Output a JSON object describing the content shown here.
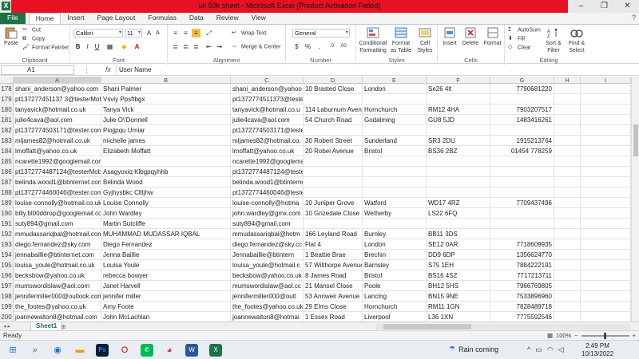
{
  "window": {
    "title": "uk 50k sheet - Microsoft Excel (Product Activation Failed)",
    "controls": [
      "?",
      "–",
      "❐",
      "✕"
    ]
  },
  "ribbon_tabs": [
    "File",
    "Home",
    "Insert",
    "Page Layout",
    "Formulas",
    "Data",
    "Review",
    "View"
  ],
  "ribbon": {
    "clipboard": {
      "paste": "Paste",
      "cut": "Cut",
      "copy": "Copy",
      "format_painter": "Format Painter",
      "label": "Clipboard"
    },
    "font": {
      "name": "Calibri",
      "size": "11",
      "label": "Font"
    },
    "alignment": {
      "wrap_text": "Wrap Text",
      "merge_center": "Merge & Center",
      "label": "Alignment"
    },
    "number": {
      "format": "General",
      "label": "Number"
    },
    "styles": {
      "conditional": "Conditional Formatting",
      "format_table": "Format as Table",
      "cell_styles": "Cell Styles",
      "label": "Styles"
    },
    "cells": {
      "insert": "Insert",
      "delete": "Delete",
      "format": "Format",
      "label": "Cells"
    },
    "editing": {
      "autosum": "AutoSum",
      "fill": "Fill",
      "clear": "Clear",
      "sort_filter": "Sort & Filter",
      "find_select": "Find & Select",
      "label": "Editing"
    }
  },
  "formula_bar": {
    "name_box": "A1",
    "fx": "fx",
    "content": "User Name"
  },
  "columns": [
    "A",
    "B",
    "C",
    "D",
    "E",
    "F",
    "G",
    "H",
    "I"
  ],
  "rows": [
    {
      "n": "178",
      "a": "shani_anderson@yahoo.com",
      "b": "Shani Palmer",
      "c": "shani_anderson@yahoo",
      "d": "10 Brasted Close",
      "e": "London",
      "f": "Se26 4lt",
      "g": "7790681220"
    },
    {
      "n": "179",
      "a": "pt137277451137 3@testerMobile.com",
      "b": "Vsviy Ppsftbgx",
      "c": "pt1372774511373@testerMobile.com",
      "d": "",
      "e": "",
      "f": "",
      "g": ""
    },
    {
      "n": "180",
      "a": "tanyavick@hotmail.co.uk",
      "b": "Tanya Vick",
      "c": "tanyavick@hotmail.co.u",
      "d": "114 Laburnum Avenu",
      "e": "Hornchurch",
      "f": "RM12 4HA",
      "g": "7903207517"
    },
    {
      "n": "181",
      "a": "julie4cava@aol.com",
      "b": "Julie O\\'Donnell",
      "c": "julie4cava@aol.com",
      "d": "54 Church Road",
      "e": "Godalming",
      "f": "GU8 5JD",
      "g": "1483416261"
    },
    {
      "n": "182",
      "a": "pt1372774503171@tester.com",
      "b": "Piojjpqu Urniar",
      "c": "pt1372774503171@tester.com",
      "d": "",
      "e": "",
      "f": "",
      "g": ""
    },
    {
      "n": "183",
      "a": "mljames82@hotmail.co.uk",
      "b": "michelle james",
      "c": "mljames82@hotmail.co.",
      "d": "30 Robert Street",
      "e": "Sunderland",
      "f": "SR3 2DU",
      "g": "1915213764"
    },
    {
      "n": "184",
      "a": "lmoffatt@yahoo.co.uk",
      "b": "Elizabeth Moffatt",
      "c": "lmoffatt@yahoo.co.uk",
      "d": "20 Robel Avenue",
      "e": "Bristol",
      "f": "BS36 2BZ",
      "g": "01454 778259"
    },
    {
      "n": "185",
      "a": "ncarette1992@googlemail.com",
      "b": "",
      "c": "ncarette1992@googlemail.com",
      "d": "",
      "e": "",
      "f": "",
      "g": ""
    },
    {
      "n": "186",
      "a": "pt1372774487124@testerMobile.com",
      "b": "Asagyoxiq Klbgpqyhhb",
      "c": "pt1372774487124@testerMobile.com",
      "d": "",
      "e": "",
      "f": "",
      "g": ""
    },
    {
      "n": "187",
      "a": "belinda.wood1@btinternet.com",
      "b": "Belinda Wood",
      "c": "belinda.wood1@btinternet.com",
      "d": "",
      "e": "",
      "f": "",
      "g": ""
    },
    {
      "n": "188",
      "a": "pt1372774460046@tester.com",
      "b": "Gyjhysbkc Cltljhw",
      "c": "pt1372774460046@tester.com",
      "d": "",
      "e": "",
      "f": "",
      "g": ""
    },
    {
      "n": "189",
      "a": "louise-connolly@hotmail.co.uk",
      "b": "Louise Connolly",
      "c": "louise-connolly@hotma",
      "d": "10 Juniper Grove",
      "e": "Watford",
      "f": "WD17 4RZ",
      "g": "7709437496"
    },
    {
      "n": "190",
      "a": "billy.bl00ddrop@googlemail.com",
      "b": "John Wardley",
      "c": "john.wardley@gmx.com",
      "d": "10 Grizedale Close",
      "e": "Wetherby",
      "f": "LS22 6FQ",
      "g": ""
    },
    {
      "n": "191",
      "a": "suty894@gmail.com",
      "b": "Martin Sutcliffe",
      "c": "suty894@gmail.com",
      "d": "",
      "e": "",
      "f": "",
      "g": ""
    },
    {
      "n": "192",
      "a": "mmudassariqbal@hotmail.com",
      "b": "MUHAMMAD MUDASSAR IQBAL",
      "c": "mmudassariqbal@hotm",
      "d": "166 Leyland Road",
      "e": "Burnley",
      "f": "BB11 3DS",
      "g": ""
    },
    {
      "n": "193",
      "a": "diego.fernandez@sky.com",
      "b": "Diego Fernandez",
      "c": "diego.fernandez@sky.cc",
      "d": "Flat 4",
      "e": "London",
      "f": "SE12 0AR",
      "g": "7718609935"
    },
    {
      "n": "194",
      "a": "jennabaillie@btinternet.com",
      "b": "Jenna Baillie",
      "c": "Jennabaillie@btintern",
      "d": "1 Beattie Brae",
      "e": "Brechin",
      "f": "DD9 6DP",
      "g": "1356624770"
    },
    {
      "n": "195",
      "a": "louisa_youle@hotmail.co.uk",
      "b": "Louisa Youle",
      "c": "louisa_youle@hotmail.c",
      "d": "57 Wilthorpe Avenue",
      "e": "Barnsley",
      "f": "S75 1EH",
      "g": "7884222191"
    },
    {
      "n": "196",
      "a": "becksbow@yahoo.co.uk",
      "b": "rebecca bowyer",
      "c": "becksbow@yahoo.co.uk",
      "d": "8 James Road",
      "e": "Bristol",
      "f": "BS16 4SZ",
      "g": "7717213711"
    },
    {
      "n": "197",
      "a": "mumswordislaw@aol.com",
      "b": "Janet Harvell",
      "c": "mumswordislaw@aol.cc",
      "d": "21 Mansel Close",
      "e": "Poole",
      "f": "BH12 5HS",
      "g": "7966769805"
    },
    {
      "n": "198",
      "a": "jennifermiller000@outlook.com",
      "b": "jennifer miller",
      "c": "jennifermiller000@outl",
      "d": "53 Annweir Avenue",
      "e": "Lancing",
      "f": "BN15 9NE",
      "g": "7533896960"
    },
    {
      "n": "199",
      "a": "the_footes@yahoo.co.uk",
      "b": "Amy Foote",
      "c": "the_footes@yahoo.co.uk",
      "d": "29 Elms Close",
      "e": "Hornchurch",
      "f": "RM11 1GN",
      "g": "7828489718"
    },
    {
      "n": "200",
      "a": "joannewalton8@hotmail.com",
      "b": "John McLachlan",
      "c": "joannewalton8@hotmai",
      "d": "1 Essex Road",
      "e": "Liverpool",
      "f": "L36 1XN",
      "g": "7775592546"
    }
  ],
  "sheet_tab": "Sheet1",
  "status": {
    "text": "Ready",
    "zoom": "100%"
  },
  "taskbar": {
    "weather": "Rain coming",
    "time": "2:49 PM",
    "date": "10/13/2022"
  }
}
